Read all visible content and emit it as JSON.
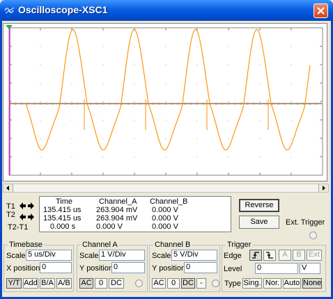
{
  "window": {
    "title": "Oscilloscope-XSC1"
  },
  "colors": {
    "trace": "#ff8c00",
    "cursor_t1": "#e000e0",
    "cursor_t2": "#ff8c00"
  },
  "cursors": {
    "t1_label": "T1",
    "t2_label": "T2",
    "diff_label": "T2-T1",
    "headers": {
      "time": "Time",
      "channel_a": "Channel_A",
      "channel_b": "Channel_B"
    },
    "rows": [
      {
        "time": "135.415 us",
        "channel_a": "263.904 mV",
        "channel_b": "0.000 V"
      },
      {
        "time": "135.415 us",
        "channel_a": "263.904 mV",
        "channel_b": "0.000 V"
      },
      {
        "time": "0.000 s",
        "channel_a": "0.000 V",
        "channel_b": "0.000 V"
      }
    ]
  },
  "buttons": {
    "reverse": "Reverse",
    "save": "Save",
    "ext_trigger": "Ext. Trigger"
  },
  "timebase": {
    "title": "Timebase",
    "scale_label": "Scale",
    "scale_value": "5 us/Div",
    "xpos_label": "X position",
    "xpos_value": "0",
    "modes": [
      "Y/T",
      "Add",
      "B/A",
      "A/B"
    ]
  },
  "channel_a": {
    "title": "Channel A",
    "scale_label": "Scale",
    "scale_value": "1  V/Div",
    "ypos_label": "Y position",
    "ypos_value": "0",
    "coupling": [
      "AC",
      "0",
      "DC"
    ]
  },
  "channel_b": {
    "title": "Channel B",
    "scale_label": "Scale",
    "scale_value": "5  V/Div",
    "ypos_label": "Y position",
    "ypos_value": "0",
    "coupling": [
      "AC",
      "0",
      "DC",
      "-"
    ]
  },
  "trigger": {
    "title": "Trigger",
    "edge_label": "Edge",
    "level_label": "Level",
    "level_value": "0",
    "level_unit": "V",
    "sources": [
      "A",
      "B",
      "Ext"
    ],
    "type_label": "Type",
    "types": [
      "Sing.",
      "Nor.",
      "Auto",
      "None"
    ]
  }
}
